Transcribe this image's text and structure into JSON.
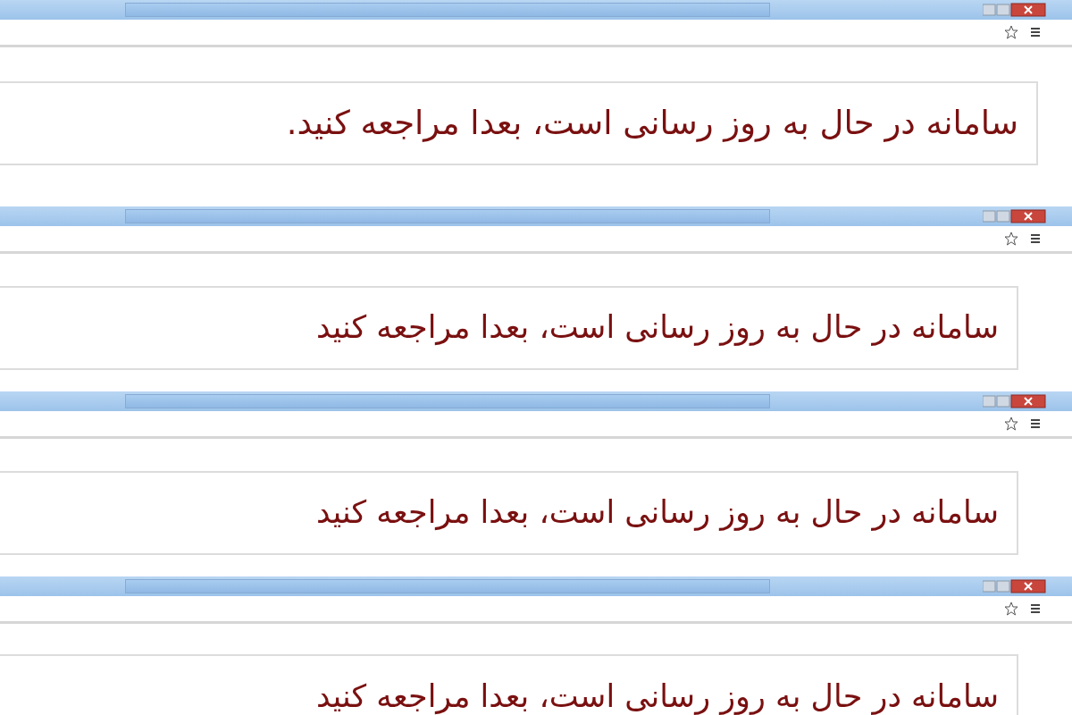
{
  "panels": [
    {
      "message": "سامانه در حال به روز رسانی است، بعدا مراجعه کنید."
    },
    {
      "message": "سامانه در حال به روز رسانی است، بعدا مراجعه کنید"
    },
    {
      "message": "سامانه در حال به روز رسانی است، بعدا مراجعه کنید"
    },
    {
      "message": "سامانه در حال به روز رسانی است، بعدا مراجعه کنید"
    }
  ]
}
